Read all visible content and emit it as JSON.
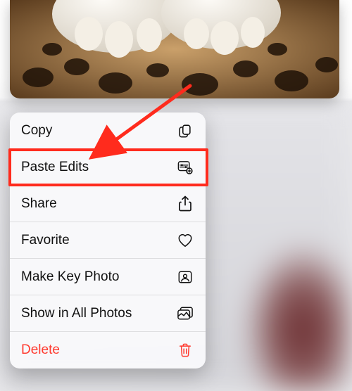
{
  "callout": {
    "highlight_index": 1,
    "highlight_color": "#ff2b1d",
    "arrow_color": "#ff2b1d"
  },
  "menu": {
    "items": [
      {
        "key": "copy",
        "label": "Copy",
        "icon": "copy-icon",
        "destructive": false
      },
      {
        "key": "paste-edits",
        "label": "Paste Edits",
        "icon": "paste-edits-icon",
        "destructive": false
      },
      {
        "key": "share",
        "label": "Share",
        "icon": "share-icon",
        "destructive": false
      },
      {
        "key": "favorite",
        "label": "Favorite",
        "icon": "heart-icon",
        "destructive": false
      },
      {
        "key": "key-photo",
        "label": "Make Key Photo",
        "icon": "key-photo-icon",
        "destructive": false
      },
      {
        "key": "show-all",
        "label": "Show in All Photos",
        "icon": "all-photos-icon",
        "destructive": false
      },
      {
        "key": "delete",
        "label": "Delete",
        "icon": "trash-icon",
        "destructive": true
      }
    ]
  },
  "colors": {
    "destructive": "#ff3b30"
  }
}
